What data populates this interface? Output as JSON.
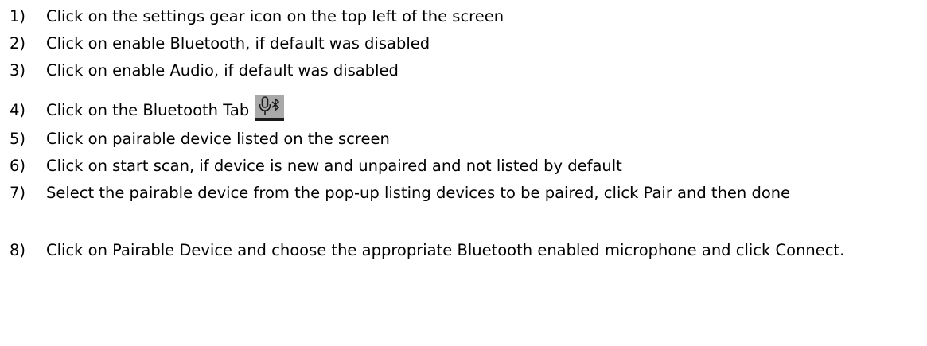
{
  "steps": [
    {
      "num": "1)",
      "text": "Click on the settings gear icon on the top left of the screen"
    },
    {
      "num": "2)",
      "text": "Click on enable Bluetooth, if default was disabled"
    },
    {
      "num": "3)",
      "text": "Click on enable Audio, if default was disabled"
    },
    {
      "num": "4)",
      "text": "Click on the Bluetooth Tab",
      "icon": "microphone-bluetooth-icon"
    },
    {
      "num": "5)",
      "text": "Click on pairable device listed on the screen"
    },
    {
      "num": "6)",
      "text": "Click on start scan, if device is new and unpaired and not listed by default"
    },
    {
      "num": "7)",
      "text": "Select the pairable device from the pop-up listing devices to be paired, click Pair and then done"
    },
    {
      "num": "8)",
      "text": "Click on Pairable Device and choose the appropriate Bluetooth enabled microphone and click Connect."
    }
  ],
  "colors": {
    "text": "#000000",
    "icon_background": "#a9a9a9",
    "icon_foreground": "#1a1a1a"
  }
}
